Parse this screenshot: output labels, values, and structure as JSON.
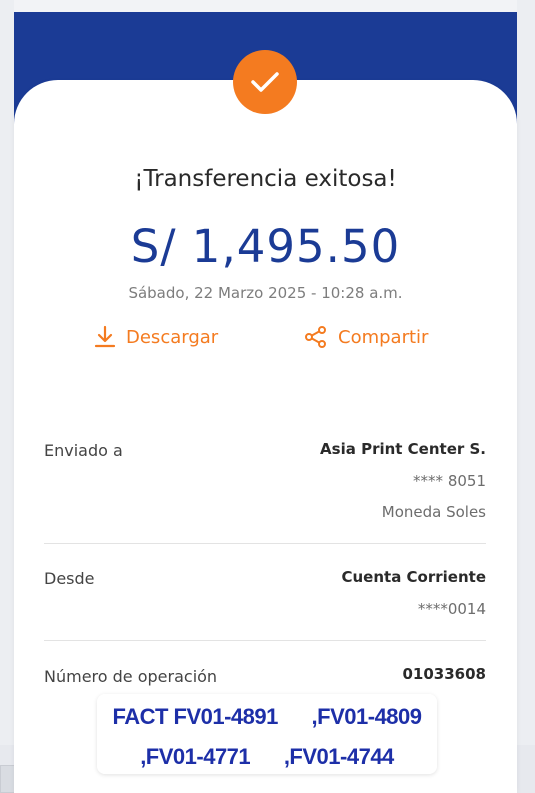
{
  "receipt": {
    "title": "¡Transferencia exitosa!",
    "amount": "S/ 1,495.50",
    "datetime": "Sábado, 22 Marzo 2025 - 10:28 a.m.",
    "download_label": "Descargar",
    "share_label": "Compartir"
  },
  "details": {
    "sent_to_label": "Enviado a",
    "sent_to_name": "Asia Print Center S.",
    "sent_to_account": "**** 8051",
    "sent_to_currency": "Moneda Soles",
    "from_label": "Desde",
    "from_account_type": "Cuenta Corriente",
    "from_account_number": "****0014",
    "operation_label": "Número de operación",
    "operation_number": "01033608"
  },
  "annotation": {
    "line1": "FACT FV01-4891      ,FV01-4809",
    "line2": ",FV01-4771      ,FV01-4744"
  },
  "colors": {
    "brand_blue": "#1b3b95",
    "accent_orange": "#f47b20"
  }
}
